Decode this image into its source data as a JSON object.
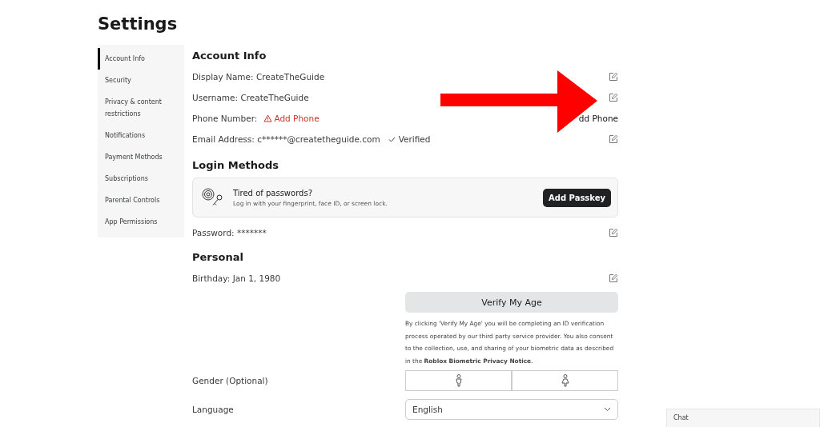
{
  "title": "Settings",
  "sidebar": {
    "items": [
      {
        "label": "Account Info",
        "selected": true
      },
      {
        "label": "Security",
        "selected": false
      },
      {
        "label": "Privacy & content restrictions",
        "selected": false
      },
      {
        "label": "Notifications",
        "selected": false
      },
      {
        "label": "Payment Methods",
        "selected": false
      },
      {
        "label": "Subscriptions",
        "selected": false
      },
      {
        "label": "Parental Controls",
        "selected": false
      },
      {
        "label": "App Permissions",
        "selected": false
      }
    ]
  },
  "account_info": {
    "heading": "Account Info",
    "rows": [
      {
        "kind": "edit",
        "text": "Display Name: CreateTheGuide"
      },
      {
        "kind": "edit",
        "text": "Username: CreateTheGuide"
      },
      {
        "kind": "phone",
        "label": "Phone Number:",
        "warning": "Add Phone",
        "action": "dd Phone"
      },
      {
        "kind": "email",
        "text": "Email Address: c******@createtheguide.com",
        "status": "Verified"
      }
    ]
  },
  "login_methods": {
    "heading": "Login Methods",
    "passkey_card": {
      "title": "Tired of passwords?",
      "subtitle": "Log in with your fingerprint, face ID, or screen lock.",
      "button": "Add Passkey"
    },
    "password": "Password: *******"
  },
  "personal": {
    "heading": "Personal",
    "birthday": "Birthday: Jan 1, 1980",
    "verify_button": "Verify My Age",
    "notice": "By clicking 'Verify My Age' you will be completing an ID verification process operated by our third party service provider. You also consent to the collection, use, and sharing of your biometric data as described in the **Roblox Biometric Privacy Notice**.",
    "gender_label": "Gender (Optional)",
    "language_label": "Language",
    "language_value": "English"
  },
  "chat": {
    "label": "Chat"
  }
}
